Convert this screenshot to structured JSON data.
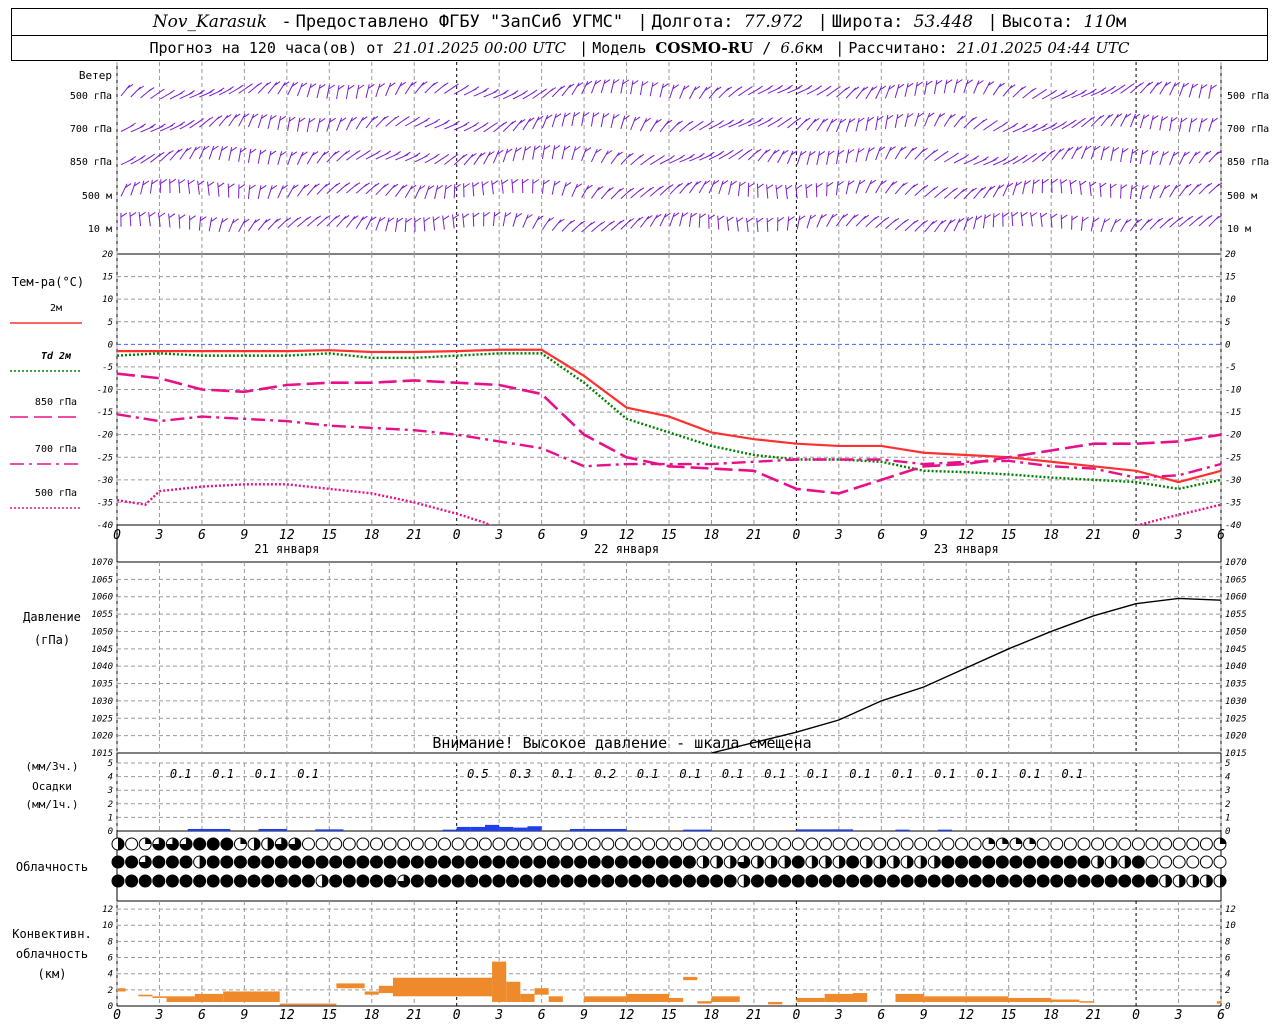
{
  "header": {
    "station": "Nov_Karasuk",
    "provider": "Предоставлено ФГБУ \"ЗапСиб УГМС\"",
    "lon_label": "Долгота:",
    "lon": "77.972",
    "lat_label": "Широта:",
    "lat": "53.448",
    "alt_label": "Высота:",
    "alt": "110",
    "alt_unit": "м",
    "forecast_prefix": "Прогноз на 120 часа(ов) от",
    "forecast_time": "21.01.2025 00:00 UTC",
    "model_label": "Модель",
    "model_name": "COSMO-RU",
    "model_res": "6.6",
    "model_res_unit": "км",
    "calc_label": "Рассчитано:",
    "calc_time": "21.01.2025 04:44 UTC"
  },
  "panels": {
    "wind": {
      "title": "Ветер",
      "levels": [
        "500 гПа",
        "700 гПа",
        "850 гПа",
        "500  м",
        "10  м"
      ]
    },
    "temp": {
      "title": "Тем-ра(°С)",
      "legend": [
        {
          "label": "2м",
          "color": "#ff3030",
          "style": "solid"
        },
        {
          "label": "Td  2м",
          "color": "#008000",
          "style": "dotted"
        },
        {
          "label": "850 гПа",
          "color": "#e8108a",
          "style": "longdash"
        },
        {
          "label": "700 гПа",
          "color": "#e8108a",
          "style": "dashdot"
        },
        {
          "label": "500 гПа",
          "color": "#e8108a",
          "style": "dotted"
        }
      ]
    },
    "pressure": {
      "title": "Давление",
      "unit": "(гПа)",
      "warning": "Внимание! Высокое давление - шкала смещена"
    },
    "precip": {
      "unit_top": "(мм/3ч.)",
      "title": "Осадки",
      "unit_bottom": "(мм/1ч.)"
    },
    "cloud": {
      "title": "Облачность"
    },
    "conv": {
      "title_1": "Конвективн.",
      "title_2": "облачность",
      "unit": "(км)"
    }
  },
  "chart_data": {
    "type": "meteogram",
    "x_ticks": [
      "0",
      "3",
      "6",
      "9",
      "12",
      "15",
      "18",
      "21",
      "0",
      "3",
      "6",
      "9",
      "12",
      "15",
      "18",
      "21",
      "0",
      "3",
      "6",
      "9",
      "12",
      "15",
      "18",
      "21",
      "0",
      "3",
      "6"
    ],
    "day_labels": [
      "21 января",
      "22 января",
      "23 января"
    ],
    "temp": {
      "ylim": [
        -40,
        20
      ],
      "yticks": [
        20,
        15,
        10,
        5,
        0,
        -5,
        -10,
        -15,
        -20,
        -25,
        -30,
        -35,
        -40
      ],
      "series": [
        {
          "name": "2м",
          "x": [
            0,
            3,
            6,
            9,
            12,
            15,
            18,
            21,
            24,
            27,
            30,
            33,
            36,
            39,
            42,
            45,
            48,
            51,
            54,
            57,
            60,
            63,
            66,
            69,
            72,
            75,
            78
          ],
          "y": [
            -1.5,
            -1.5,
            -1.5,
            -1.5,
            -1.5,
            -1.3,
            -1.7,
            -1.7,
            -1.5,
            -1.2,
            -1.2,
            -7,
            -14,
            -16,
            -19.5,
            -21,
            -22,
            -22.5,
            -22.5,
            -24,
            -24.5,
            -25,
            -26,
            -27,
            -28,
            -30.5,
            -28
          ]
        },
        {
          "name": "Td  2м",
          "x": [
            0,
            3,
            6,
            9,
            12,
            15,
            18,
            21,
            24,
            27,
            30,
            33,
            36,
            39,
            42,
            45,
            48,
            51,
            54,
            57,
            60,
            63,
            66,
            69,
            72,
            75,
            78
          ],
          "y": [
            -2.5,
            -2,
            -2.5,
            -2.5,
            -2.5,
            -2,
            -3,
            -3,
            -2.5,
            -2,
            -2,
            -8.5,
            -16.5,
            -19.5,
            -22.5,
            -24.5,
            -25.5,
            -25.5,
            -26,
            -28,
            -28.3,
            -28.8,
            -29.5,
            -30,
            -30.5,
            -32,
            -30
          ]
        },
        {
          "name": "850 гПа",
          "x": [
            0,
            3,
            6,
            9,
            12,
            15,
            18,
            21,
            24,
            27,
            30,
            33,
            36,
            39,
            42,
            45,
            48,
            51,
            54,
            57,
            60,
            63,
            66,
            69,
            72,
            75,
            78
          ],
          "y": [
            -6.5,
            -7.5,
            -10,
            -10.5,
            -9,
            -8.5,
            -8.5,
            -8,
            -8.5,
            -9,
            -11,
            -20,
            -25,
            -27,
            -27.5,
            -28,
            -32,
            -33,
            -30,
            -27,
            -26.5,
            -25,
            -23.5,
            -22,
            -22,
            -21.5,
            -20
          ]
        },
        {
          "name": "700 гПа",
          "x": [
            0,
            3,
            6,
            9,
            12,
            15,
            18,
            21,
            24,
            27,
            30,
            33,
            36,
            39,
            42,
            45,
            48,
            51,
            54,
            57,
            60,
            63,
            66,
            69,
            72,
            75,
            78
          ],
          "y": [
            -15.5,
            -17,
            -16,
            -16.5,
            -17,
            -18,
            -18.5,
            -19,
            -20,
            -21.5,
            -23,
            -27,
            -26.5,
            -26.5,
            -26.5,
            -26,
            -25.5,
            -25.5,
            -25.5,
            -26.5,
            -26,
            -25.8,
            -27,
            -27.5,
            -29.5,
            -29,
            -26.5
          ]
        },
        {
          "name": "500 гПа",
          "x": [
            0,
            2,
            3,
            6,
            9,
            12,
            15,
            18,
            21,
            24,
            26,
            27,
            71,
            74,
            78
          ],
          "y": [
            -34.5,
            -35.5,
            -32.5,
            -31.5,
            -31,
            -31,
            -32,
            -33,
            -35,
            -37.5,
            -39.5,
            -41,
            -41,
            -38.5,
            -35.5
          ]
        }
      ]
    },
    "pressure": {
      "ylim": [
        1015,
        1070
      ],
      "yticks": [
        1070,
        1065,
        1060,
        1055,
        1050,
        1045,
        1040,
        1035,
        1030,
        1025,
        1020,
        1015
      ],
      "x": [
        42,
        45,
        48,
        51,
        54,
        57,
        60,
        63,
        66,
        69,
        72,
        75,
        78
      ],
      "y": [
        1015,
        1018,
        1021,
        1024.5,
        1030,
        1034,
        1039.5,
        1045,
        1050,
        1054.5,
        1058,
        1059.5,
        1059
      ]
    },
    "precip": {
      "ylim": [
        0,
        5
      ],
      "yticks": [
        5,
        4,
        3,
        2,
        1,
        0
      ],
      "labels": [
        {
          "x": 4.5,
          "text": "0.1"
        },
        {
          "x": 7.5,
          "text": "0.1"
        },
        {
          "x": 10.5,
          "text": "0.1"
        },
        {
          "x": 13.5,
          "text": "0.1"
        },
        {
          "x": 25.5,
          "text": "0.5"
        },
        {
          "x": 28.5,
          "text": "0.3"
        },
        {
          "x": 31.5,
          "text": "0.1"
        },
        {
          "x": 34.5,
          "text": "0.2"
        },
        {
          "x": 37.5,
          "text": "0.1"
        },
        {
          "x": 40.5,
          "text": "0.1"
        },
        {
          "x": 43.5,
          "text": "0.1"
        },
        {
          "x": 46.5,
          "text": "0.1"
        },
        {
          "x": 49.5,
          "text": "0.1"
        },
        {
          "x": 52.5,
          "text": "0.1"
        },
        {
          "x": 55.5,
          "text": "0.1"
        },
        {
          "x": 58.5,
          "text": "0.1"
        },
        {
          "x": 61.5,
          "text": "0.1"
        },
        {
          "x": 64.5,
          "text": "0.1"
        },
        {
          "x": 67.5,
          "text": "0.1"
        }
      ],
      "hourly": [
        {
          "x0": 5,
          "x1": 8,
          "v": 0.15
        },
        {
          "x0": 10,
          "x1": 12,
          "v": 0.15
        },
        {
          "x0": 14,
          "x1": 16,
          "v": 0.12
        },
        {
          "x0": 23,
          "x1": 24,
          "v": 0.1
        },
        {
          "x0": 24,
          "x1": 25,
          "v": 0.3
        },
        {
          "x0": 25,
          "x1": 26,
          "v": 0.3
        },
        {
          "x0": 26,
          "x1": 27,
          "v": 0.45
        },
        {
          "x0": 27,
          "x1": 28,
          "v": 0.3
        },
        {
          "x0": 28,
          "x1": 29,
          "v": 0.25
        },
        {
          "x0": 29,
          "x1": 30,
          "v": 0.35
        },
        {
          "x0": 32,
          "x1": 36,
          "v": 0.15
        },
        {
          "x0": 40,
          "x1": 42,
          "v": 0.1
        },
        {
          "x0": 48,
          "x1": 52,
          "v": 0.12
        },
        {
          "x0": 55,
          "x1": 56,
          "v": 0.1
        },
        {
          "x0": 58,
          "x1": 59,
          "v": 0.1
        }
      ]
    },
    "conv": {
      "ylim": [
        0,
        13
      ],
      "yticks": [
        12,
        10,
        8,
        6,
        4,
        2,
        0
      ],
      "bars": [
        {
          "x0": 0,
          "x1": 0.6,
          "top": 2.2,
          "bottom": 1.8
        },
        {
          "x0": 1.5,
          "x1": 2.5,
          "top": 1.4,
          "bottom": 1.2
        },
        {
          "x0": 2.5,
          "x1": 3.5,
          "top": 1.2,
          "bottom": 1
        },
        {
          "x0": 3.5,
          "x1": 5.5,
          "top": 1.2,
          "bottom": 0.5
        },
        {
          "x0": 5.5,
          "x1": 7.5,
          "top": 1.5,
          "bottom": 0.5
        },
        {
          "x0": 7.5,
          "x1": 11.5,
          "top": 1.8,
          "bottom": 0.5
        },
        {
          "x0": 11.5,
          "x1": 15.5,
          "top": 0.3,
          "bottom": 0.1
        },
        {
          "x0": 15.5,
          "x1": 17.5,
          "top": 2.8,
          "bottom": 2.2
        },
        {
          "x0": 17.5,
          "x1": 18.5,
          "top": 1.8,
          "bottom": 1.4
        },
        {
          "x0": 18.5,
          "x1": 19.5,
          "top": 2.5,
          "bottom": 1.6
        },
        {
          "x0": 19.5,
          "x1": 26.5,
          "top": 3.5,
          "bottom": 1.2
        },
        {
          "x0": 26.5,
          "x1": 27.5,
          "top": 5.5,
          "bottom": 0.5
        },
        {
          "x0": 27.5,
          "x1": 28.5,
          "top": 3.0,
          "bottom": 0.5
        },
        {
          "x0": 28.5,
          "x1": 29.5,
          "top": 1.5,
          "bottom": 0.5
        },
        {
          "x0": 29.5,
          "x1": 30.5,
          "top": 2.2,
          "bottom": 1.4
        },
        {
          "x0": 30.5,
          "x1": 31.5,
          "top": 1.2,
          "bottom": 0.5
        },
        {
          "x0": 33,
          "x1": 36,
          "top": 1.2,
          "bottom": 0.5
        },
        {
          "x0": 36,
          "x1": 39,
          "top": 1.5,
          "bottom": 0.5
        },
        {
          "x0": 39,
          "x1": 40,
          "top": 1,
          "bottom": 0.5
        },
        {
          "x0": 40,
          "x1": 41,
          "top": 3.6,
          "bottom": 3.2
        },
        {
          "x0": 41,
          "x1": 42,
          "top": 0.6,
          "bottom": 0.3
        },
        {
          "x0": 42,
          "x1": 44,
          "top": 1.2,
          "bottom": 0.5
        },
        {
          "x0": 46,
          "x1": 47,
          "top": 0.5,
          "bottom": 0.2
        },
        {
          "x0": 48,
          "x1": 50,
          "top": 1,
          "bottom": 0.5
        },
        {
          "x0": 50,
          "x1": 52,
          "top": 1.5,
          "bottom": 0.5
        },
        {
          "x0": 52,
          "x1": 53,
          "top": 1.6,
          "bottom": 0.5
        },
        {
          "x0": 55,
          "x1": 57,
          "top": 1.5,
          "bottom": 0.5
        },
        {
          "x0": 57,
          "x1": 63,
          "top": 1.2,
          "bottom": 0.5
        },
        {
          "x0": 63,
          "x1": 66,
          "top": 1.0,
          "bottom": 0.5
        },
        {
          "x0": 66,
          "x1": 68,
          "top": 0.8,
          "bottom": 0.5
        },
        {
          "x0": 68,
          "x1": 69,
          "top": 0.6,
          "bottom": 0.5
        },
        {
          "x0": 77.7,
          "x1": 78,
          "top": 0.6,
          "bottom": 0.3
        }
      ]
    },
    "cloud_rows": {
      "high": "2013334441223300000000000000000000000000000000000000000000000000111100000000000001",
      "mid": "4434442444444444444444444444444444444444444222322242224222222444444444442224000000",
      "low": "4444444444444442444443444444444444444444444444244444444444444444444444444444422222"
    }
  }
}
